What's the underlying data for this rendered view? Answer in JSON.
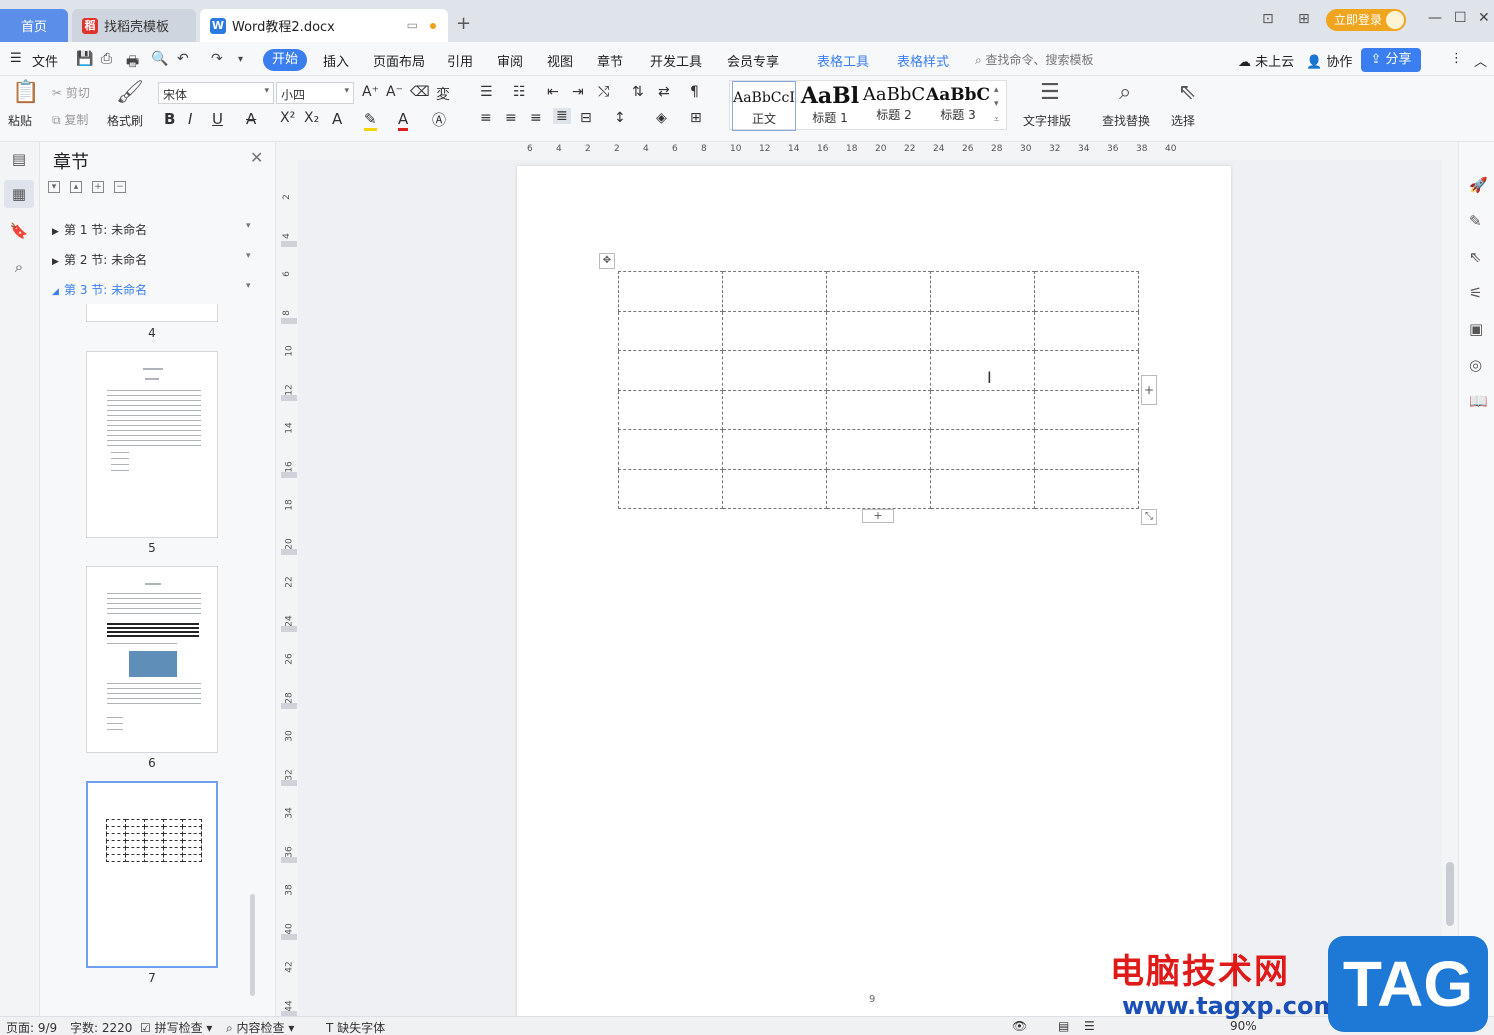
{
  "titlebar": {
    "tab_home": "首页",
    "tab_template": "找稻壳模板",
    "tab_doc": "Word教程2.docx",
    "new_tab": "+",
    "login": "立即登录"
  },
  "menu": {
    "file": "文件",
    "items": [
      "开始",
      "插入",
      "页面布局",
      "引用",
      "审阅",
      "视图",
      "章节",
      "开发工具",
      "会员专享"
    ],
    "active": "开始",
    "table_tools": "表格工具",
    "table_style": "表格样式",
    "search_cmd": "查找命令、搜索模板",
    "cloud": "未上云",
    "collab": "协作",
    "share": "分享"
  },
  "ribbon": {
    "paste": "粘贴",
    "cut": "剪切",
    "copy": "复制",
    "format_painter": "格式刷",
    "font_name": "宋体",
    "font_size": "小四",
    "styles": [
      {
        "preview": "AaBbCcI",
        "name": "正文"
      },
      {
        "preview": "AaBl",
        "name": "标题 1"
      },
      {
        "preview": "AaBbC",
        "name": "标题 2"
      },
      {
        "preview": "AaBbC",
        "name": "标题 3"
      }
    ],
    "text_layout": "文字排版",
    "find_replace": "查找替换",
    "select": "选择"
  },
  "chapter_panel": {
    "title": "章节",
    "sections": [
      {
        "label": "第 1 节: 未命名"
      },
      {
        "label": "第 2 节: 未命名"
      },
      {
        "label": "第 3 节: 未命名"
      }
    ],
    "page_numbers": [
      "4",
      "5",
      "6",
      "7"
    ]
  },
  "ruler": {
    "h_ticks": [
      "6",
      "4",
      "2",
      "2",
      "4",
      "6",
      "8",
      "10",
      "12",
      "14",
      "16",
      "18",
      "20",
      "22",
      "24",
      "26",
      "28",
      "30",
      "32",
      "34",
      "36",
      "38",
      "40"
    ],
    "v_ticks": [
      "2",
      "4",
      "6",
      "8",
      "10",
      "12",
      "14",
      "16",
      "18",
      "20",
      "22",
      "24",
      "26",
      "28",
      "30",
      "32",
      "34",
      "36",
      "38",
      "40",
      "42",
      "44"
    ]
  },
  "document": {
    "table_rows": 6,
    "table_cols": 5,
    "page_footer": "9"
  },
  "statusbar": {
    "page": "页面: 9/9",
    "words": "字数: 2220",
    "spell": "拼写检查",
    "content_check": "内容检查",
    "missing_font": "缺失字体",
    "zoom": "90%"
  },
  "watermark": {
    "cn": "电脑技术网",
    "url": "www.tagxp.com",
    "tag": "TAG"
  }
}
